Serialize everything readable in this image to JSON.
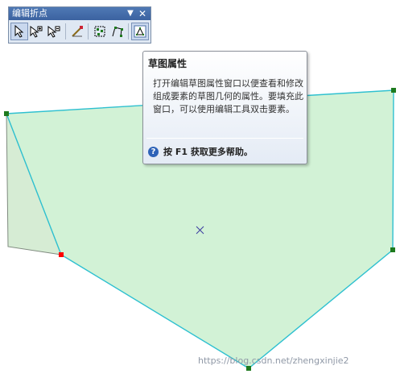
{
  "toolbar": {
    "title": "编辑折点",
    "menu_icon": "dropdown-arrow-icon",
    "close_icon": "close-icon",
    "tools": [
      "edit-vertices-pointer-icon",
      "add-vertex-icon",
      "delete-vertex-icon",
      "continue-feature-icon",
      "select-vertices-icon",
      "modify-vertex-icon",
      "sketch-properties-icon"
    ]
  },
  "tooltip": {
    "title": "草图属性",
    "body": "打开编辑草图属性窗口以便查看和修改组成要素的草图几何的属性。要填充此窗口，可以使用编辑工具双击要素。",
    "help": "按 F1 获取更多帮助。"
  },
  "colors": {
    "selected_fill": "#d2f2d6",
    "selected_outline": "#2ec0d0",
    "vertex": "#1e7a1e",
    "active_vertex": "#ff0000",
    "other_fill": "#d6ecd4"
  },
  "watermark": "https://blog.csdn.net/zhengxinjie2"
}
